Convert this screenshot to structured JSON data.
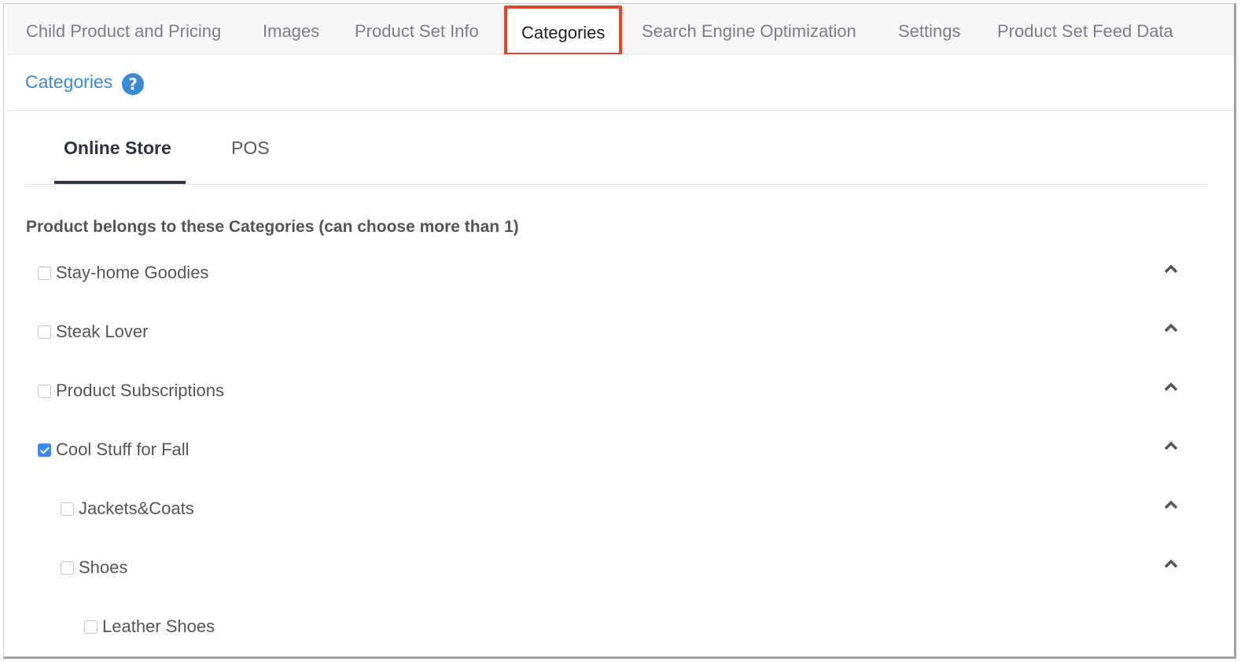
{
  "top_tabs": [
    {
      "label": "Child Product and Pricing",
      "active": false
    },
    {
      "label": "Images",
      "active": false
    },
    {
      "label": "Product Set Info",
      "active": false
    },
    {
      "label": "Categories",
      "active": true
    },
    {
      "label": "Search Engine Optimization",
      "active": false
    },
    {
      "label": "Settings",
      "active": false
    },
    {
      "label": "Product Set Feed Data",
      "active": false
    }
  ],
  "section": {
    "title": "Categories",
    "help_icon": "question-circle-icon"
  },
  "sub_tabs": [
    {
      "label": "Online Store",
      "active": true
    },
    {
      "label": "POS",
      "active": false
    }
  ],
  "categories_heading": "Product belongs to these Categories (can choose more than 1)",
  "categories": [
    {
      "label": "Stay-home Goodies",
      "checked": false,
      "level": 0,
      "expandable": true
    },
    {
      "label": "Steak Lover",
      "checked": false,
      "level": 0,
      "expandable": true
    },
    {
      "label": "Product Subscriptions",
      "checked": false,
      "level": 0,
      "expandable": true
    },
    {
      "label": "Cool Stuff for Fall",
      "checked": true,
      "level": 0,
      "expandable": true
    },
    {
      "label": "Jackets&Coats",
      "checked": false,
      "level": 1,
      "expandable": true
    },
    {
      "label": "Shoes",
      "checked": false,
      "level": 1,
      "expandable": true
    },
    {
      "label": "Leather Shoes",
      "checked": false,
      "level": 2,
      "expandable": false
    }
  ],
  "colors": {
    "accent": "#3a8ad6",
    "highlight_border": "#e0452d",
    "checkbox_checked": "#3f86ee"
  }
}
